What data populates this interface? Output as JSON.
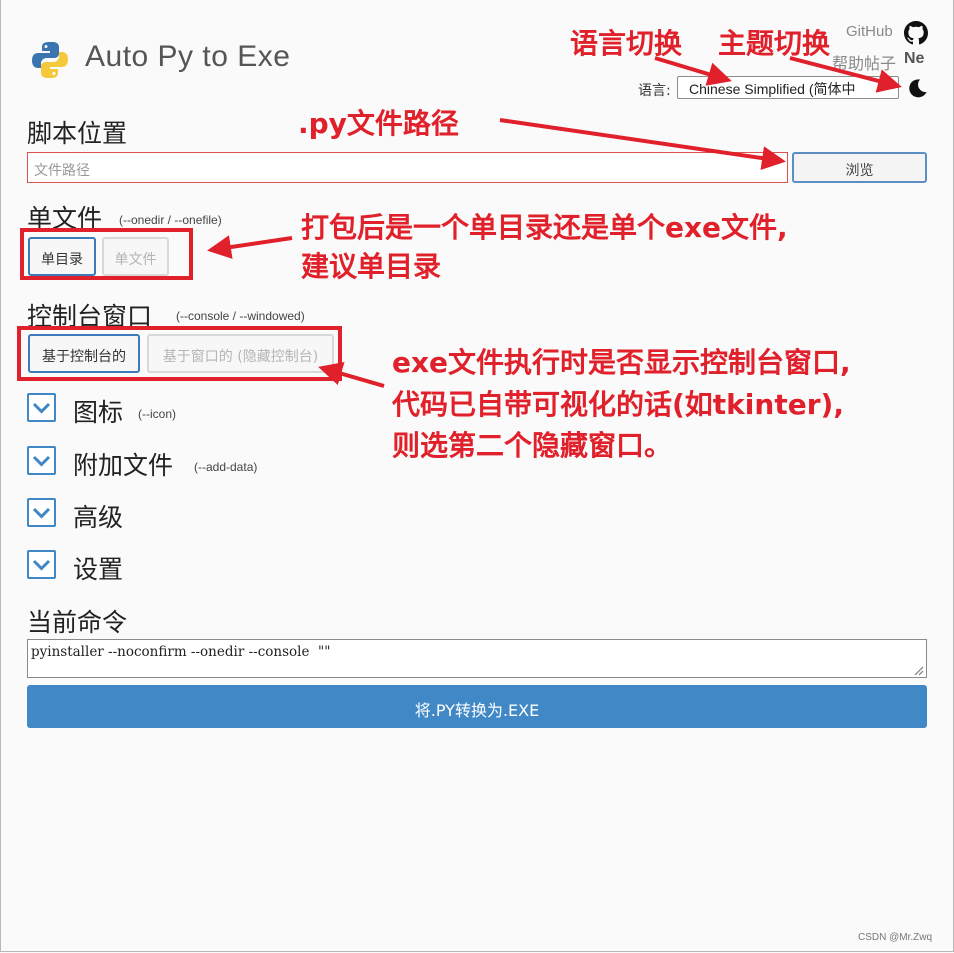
{
  "app": {
    "title": "Auto Py to Exe",
    "links": {
      "github": "GitHub",
      "help": "帮助帖子",
      "help_suffix": "Ne"
    },
    "language": {
      "label": "语言:",
      "selected": "Chinese Simplified (简体中"
    }
  },
  "script_location": {
    "heading": "脚本位置",
    "placeholder": "文件路径",
    "browse": "浏览"
  },
  "onefile": {
    "heading": "单文件",
    "flags": "(--onedir / --onefile)",
    "options": [
      "单目录",
      "单文件"
    ],
    "selected": "单目录"
  },
  "console": {
    "heading": "控制台窗口",
    "flags": "(--console / --windowed)",
    "options": [
      "基于控制台的",
      "基于窗口的 (隐藏控制台)"
    ],
    "selected": "基于控制台的"
  },
  "sections": [
    {
      "label": "图标",
      "flag": "(--icon)"
    },
    {
      "label": "附加文件",
      "flag": "(--add-data)"
    },
    {
      "label": "高级",
      "flag": ""
    },
    {
      "label": "设置",
      "flag": ""
    }
  ],
  "current_command": {
    "heading": "当前命令",
    "value": "pyinstaller --noconfirm --onedir --console  \"\""
  },
  "convert_button": "将.PY转换为.EXE",
  "annotations": {
    "language_switch": "语言切换",
    "theme_switch": "主题切换",
    "py_path": ".py文件路径",
    "onefile_line1": "打包后是一个单目录还是单个exe文件,",
    "onefile_line2": "建议单目录",
    "console_line1": "exe文件执行时是否显示控制台窗口,",
    "console_line2": "代码已自带可视化的话(如tkinter),",
    "console_line3": "则选第二个隐藏窗口。"
  },
  "watermark": "CSDN @Mr.Zwq",
  "colors": {
    "accent": "#4088c6",
    "annotation_red": "#e0202a",
    "error_border": "#d9534f"
  }
}
